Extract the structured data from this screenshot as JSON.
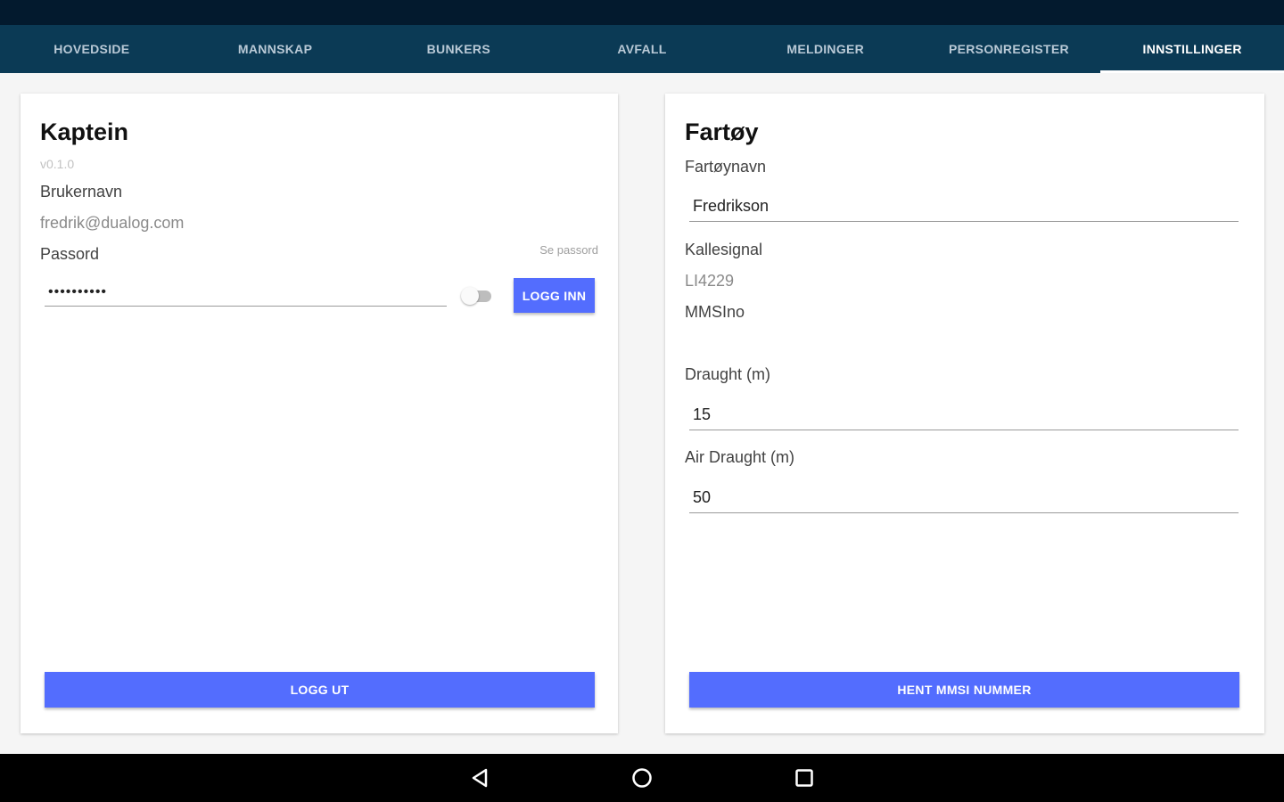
{
  "tabs": [
    {
      "label": "HOVEDSIDE",
      "active": false
    },
    {
      "label": "MANNSKAP",
      "active": false
    },
    {
      "label": "BUNKERS",
      "active": false
    },
    {
      "label": "AVFALL",
      "active": false
    },
    {
      "label": "MELDINGER",
      "active": false
    },
    {
      "label": "PERSONREGISTER",
      "active": false
    },
    {
      "label": "INNSTILLINGER",
      "active": true
    }
  ],
  "captain": {
    "title": "Kaptein",
    "version": "v0.1.0",
    "username_label": "Brukernavn",
    "username": "fredrik@dualog.com",
    "password_label": "Passord",
    "show_password_label": "Se passord",
    "password_value": "••••••••••",
    "login_button": "LOGG INN",
    "logout_button": "LOGG UT"
  },
  "vessel": {
    "title": "Fartøy",
    "name_label": "Fartøynavn",
    "name_value": "Fredrikson",
    "callsign_label": "Kallesignal",
    "callsign_value": "LI4229",
    "mmsi_label": "MMSIno",
    "draught_label": "Draught (m)",
    "draught_value": "15",
    "air_draught_label": "Air Draught (m)",
    "air_draught_value": "50",
    "fetch_mmsi_button": "HENT MMSI NUMMER"
  },
  "nav_icons": [
    "back-icon",
    "home-icon",
    "recents-icon"
  ],
  "colors": {
    "primary": "#536dfe",
    "tab_bar": "#0b3a55",
    "status_bar": "#031a2e"
  }
}
